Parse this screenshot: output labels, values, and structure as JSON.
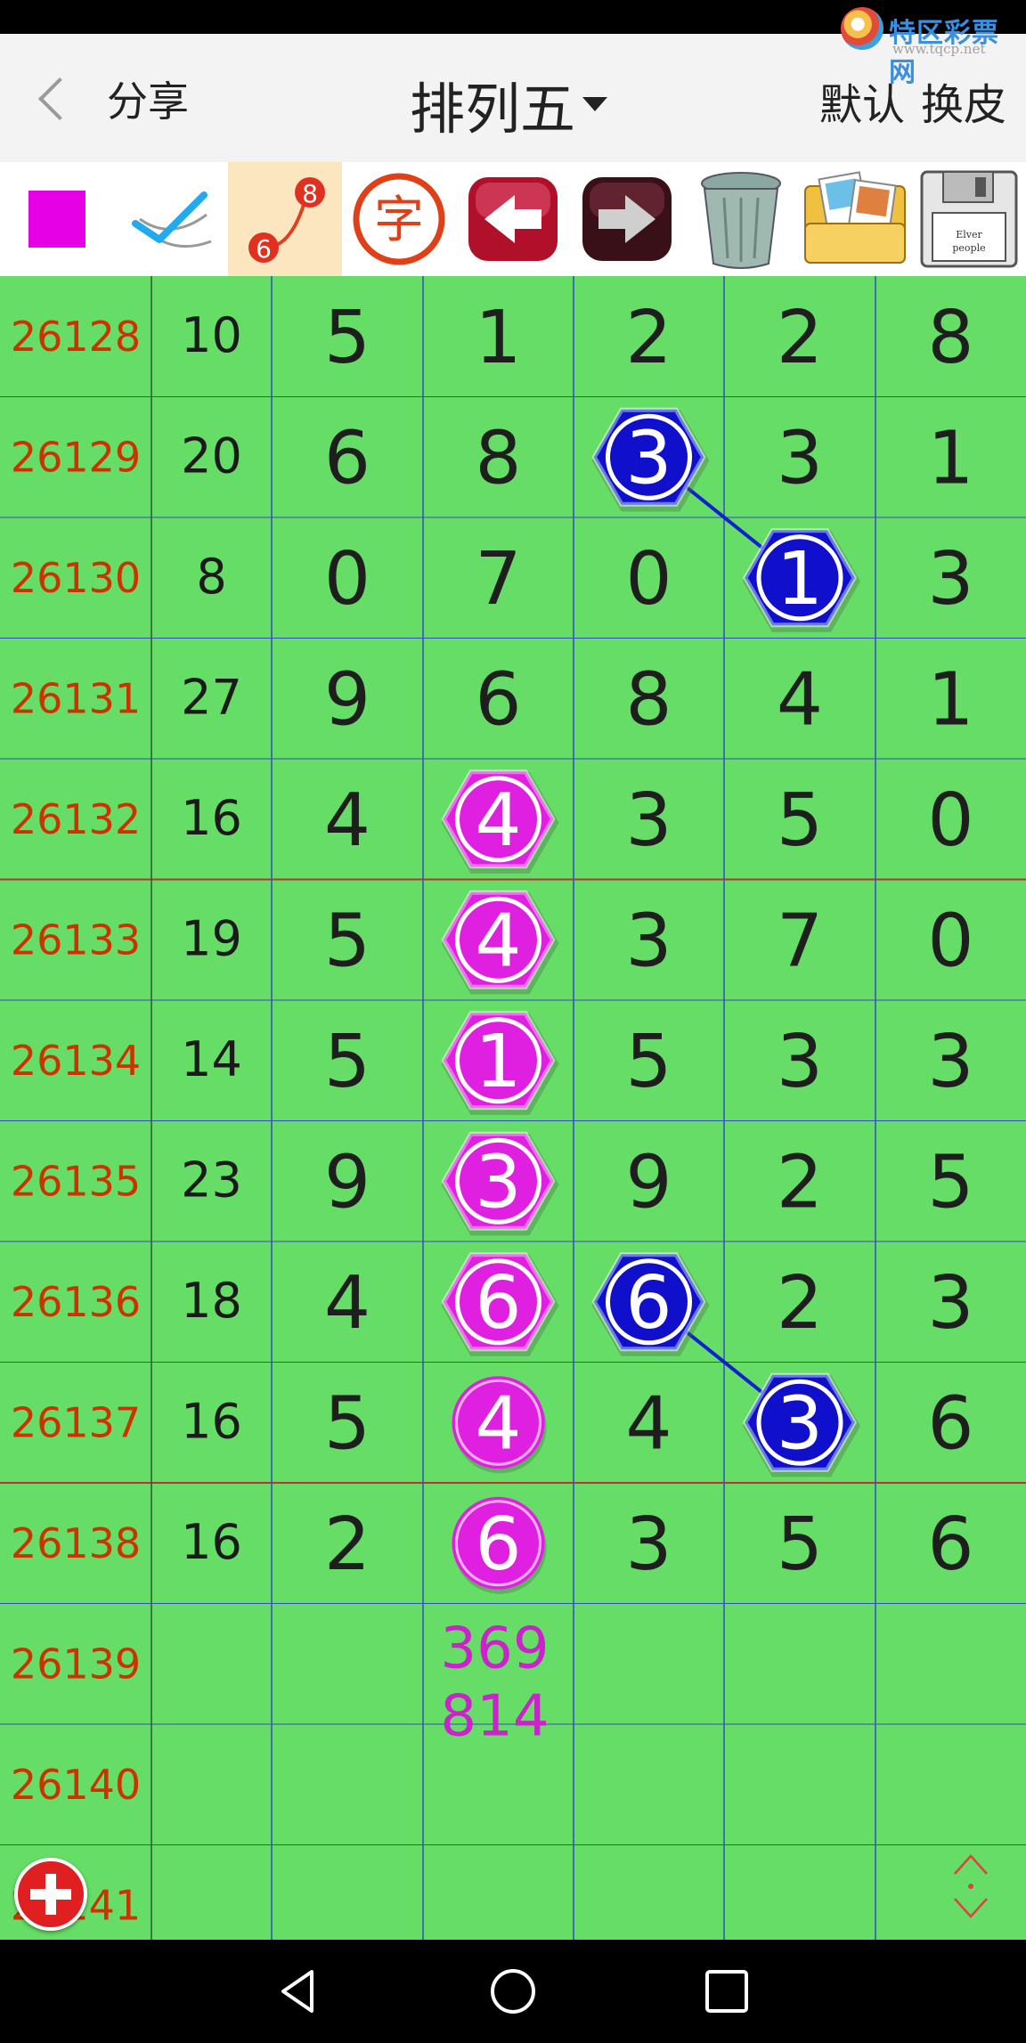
{
  "watermark": {
    "title": "特区彩票网",
    "url": "www.tqcp.net"
  },
  "header": {
    "back_label": "分享",
    "title": "排列五",
    "btn_default": "默认",
    "btn_skin": "换皮"
  },
  "toolbar": {
    "tools": [
      {
        "icon": "magenta-color-swatch-icon",
        "color": "#e600e6"
      },
      {
        "icon": "check-draw-icon"
      },
      {
        "icon": "number-line-icon",
        "n1": "8",
        "n2": "6"
      },
      {
        "icon": "text-char-icon",
        "char": "字"
      },
      {
        "icon": "back-arrow-icon"
      },
      {
        "icon": "forward-arrow-icon"
      },
      {
        "icon": "trash-icon"
      },
      {
        "icon": "photo-folder-icon"
      },
      {
        "icon": "save-disk-icon",
        "label": "Elver people"
      }
    ]
  },
  "colors": {
    "grid_bg": "#66dd66",
    "issue_text": "#cc3300",
    "magenta": "#e020e0",
    "blue": "#1010cc",
    "hline_red": "#c03030",
    "vline_blue": "#3050c0"
  },
  "rows": [
    {
      "issue": "26128",
      "sum": "10",
      "d": [
        "5",
        "1",
        "2",
        "2",
        "8"
      ]
    },
    {
      "issue": "26129",
      "sum": "20",
      "d": [
        "6",
        "8",
        "3",
        "3",
        "1"
      ]
    },
    {
      "issue": "26130",
      "sum": "8",
      "d": [
        "0",
        "7",
        "0",
        "1",
        "3"
      ]
    },
    {
      "issue": "26131",
      "sum": "27",
      "d": [
        "9",
        "6",
        "8",
        "4",
        "1"
      ]
    },
    {
      "issue": "26132",
      "sum": "16",
      "d": [
        "4",
        "4",
        "3",
        "5",
        "0"
      ]
    },
    {
      "issue": "26133",
      "sum": "19",
      "d": [
        "5",
        "4",
        "3",
        "7",
        "0"
      ]
    },
    {
      "issue": "26134",
      "sum": "14",
      "d": [
        "5",
        "1",
        "5",
        "3",
        "3"
      ]
    },
    {
      "issue": "26135",
      "sum": "23",
      "d": [
        "9",
        "3",
        "9",
        "2",
        "5"
      ]
    },
    {
      "issue": "26136",
      "sum": "18",
      "d": [
        "4",
        "6",
        "6",
        "2",
        "3"
      ]
    },
    {
      "issue": "26137",
      "sum": "16",
      "d": [
        "5",
        "4",
        "4",
        "3",
        "6"
      ]
    },
    {
      "issue": "26138",
      "sum": "16",
      "d": [
        "2",
        "6",
        "3",
        "5",
        "6"
      ]
    },
    {
      "issue": "26139",
      "sum": "",
      "d": [
        "",
        "",
        "",
        "",
        ""
      ]
    },
    {
      "issue": "26140",
      "sum": "",
      "d": [
        "",
        "",
        "",
        "",
        ""
      ]
    },
    {
      "issue": "26141",
      "sum": "",
      "d": [
        "",
        "",
        "",
        "",
        ""
      ]
    }
  ],
  "markers": [
    {
      "row": 1,
      "col": 2,
      "shape": "hex",
      "color": "blue"
    },
    {
      "row": 2,
      "col": 3,
      "shape": "hex",
      "color": "blue"
    },
    {
      "row": 4,
      "col": 1,
      "shape": "hex",
      "color": "magenta"
    },
    {
      "row": 5,
      "col": 1,
      "shape": "hex",
      "color": "magenta"
    },
    {
      "row": 6,
      "col": 1,
      "shape": "hex",
      "color": "magenta"
    },
    {
      "row": 7,
      "col": 1,
      "shape": "hex",
      "color": "magenta"
    },
    {
      "row": 8,
      "col": 1,
      "shape": "hex",
      "color": "magenta"
    },
    {
      "row": 8,
      "col": 2,
      "shape": "hex",
      "color": "blue"
    },
    {
      "row": 9,
      "col": 1,
      "shape": "circle",
      "color": "magenta"
    },
    {
      "row": 9,
      "col": 3,
      "shape": "hex",
      "color": "blue"
    },
    {
      "row": 10,
      "col": 1,
      "shape": "circle",
      "color": "magenta"
    }
  ],
  "links": [
    {
      "from": [
        1,
        2
      ],
      "to": [
        2,
        3
      ]
    },
    {
      "from": [
        8,
        2
      ],
      "to": [
        9,
        3
      ]
    }
  ],
  "prediction": {
    "row": 11,
    "col": 1,
    "line1": "369",
    "line2": "814"
  }
}
